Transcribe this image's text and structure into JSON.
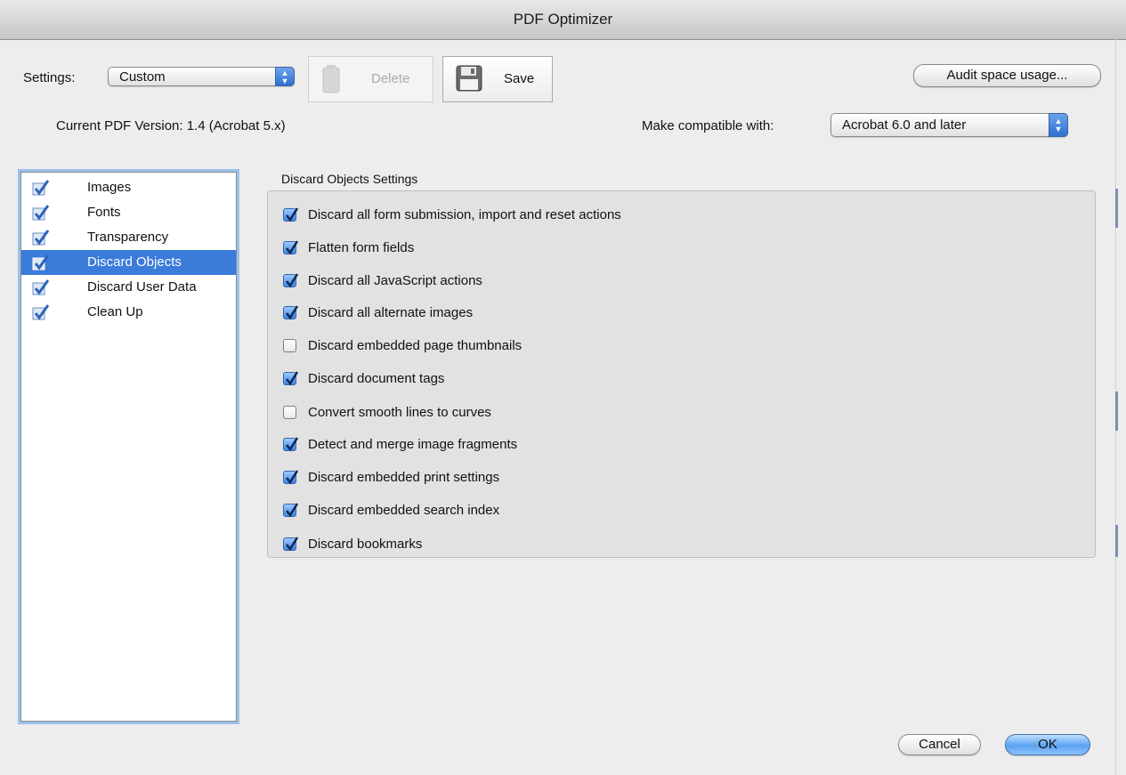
{
  "window": {
    "title": "PDF Optimizer"
  },
  "settings": {
    "label": "Settings:",
    "value": "Custom"
  },
  "toolbar": {
    "delete_label": "Delete",
    "save_label": "Save"
  },
  "audit_button": "Audit space usage...",
  "version": {
    "text": "Current PDF Version: 1.4 (Acrobat 5.x)"
  },
  "compat": {
    "label": "Make compatible with:",
    "value": "Acrobat 6.0 and later"
  },
  "sidebar": {
    "items": [
      {
        "label": "Images",
        "checked": true,
        "selected": false
      },
      {
        "label": "Fonts",
        "checked": true,
        "selected": false
      },
      {
        "label": "Transparency",
        "checked": true,
        "selected": false
      },
      {
        "label": "Discard Objects",
        "checked": true,
        "selected": true
      },
      {
        "label": "Discard User Data",
        "checked": true,
        "selected": false
      },
      {
        "label": "Clean Up",
        "checked": true,
        "selected": false
      }
    ]
  },
  "panel": {
    "title": "Discard Objects Settings",
    "options": [
      {
        "label": "Discard all form submission, import and reset actions",
        "checked": true
      },
      {
        "label": "Flatten form fields",
        "checked": true
      },
      {
        "label": "Discard all JavaScript actions",
        "checked": true
      },
      {
        "label": "Discard all alternate images",
        "checked": true
      },
      {
        "label": "Discard embedded page thumbnails",
        "checked": false
      },
      {
        "label": "Discard document tags",
        "checked": true
      },
      {
        "label": "Convert smooth lines to curves",
        "checked": false
      },
      {
        "label": "Detect and merge image fragments",
        "checked": true
      },
      {
        "label": "Discard embedded print settings",
        "checked": true
      },
      {
        "label": "Discard embedded search index",
        "checked": true
      },
      {
        "label": "Discard bookmarks",
        "checked": true
      }
    ]
  },
  "footer": {
    "cancel_label": "Cancel",
    "ok_label": "OK"
  },
  "colors": {
    "selection": "#3b7bd9",
    "accent": "#3e86e0",
    "panel_bg": "#e2e2e2",
    "window_bg": "#ededed"
  }
}
